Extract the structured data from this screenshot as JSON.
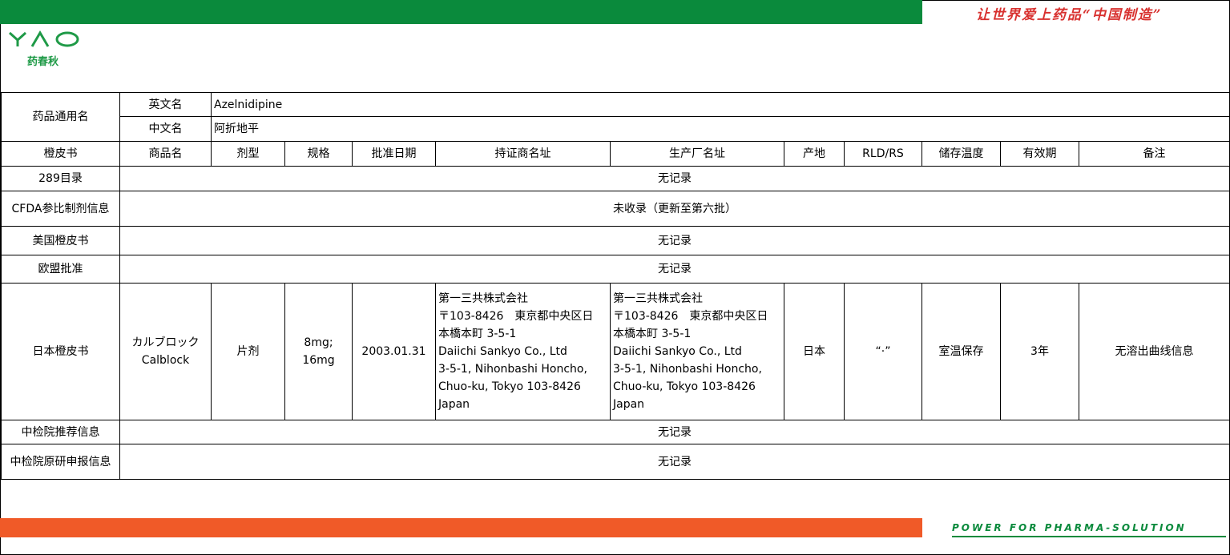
{
  "header": {
    "slogan": "让世界爱上药品“中国制造”",
    "logo_text": "YAO",
    "logo_cn": "药春秋",
    "footer_slogan": "POWER FOR PHARMA-SOLUTION"
  },
  "drug": {
    "generic_label": "药品通用名",
    "en_label": "英文名",
    "en_value": "Azelnidipine",
    "cn_label": "中文名",
    "cn_value": "阿折地平"
  },
  "columns": [
    "橙皮书",
    "商品名",
    "剂型",
    "规格",
    "批准日期",
    "持证商名址",
    "生产厂名址",
    "产地",
    "RLD/RS",
    "储存温度",
    "有效期",
    "备注"
  ],
  "rows": {
    "r289": {
      "label": "289目录",
      "value": "无记录"
    },
    "cfda": {
      "label": "CFDA参比制剂信息",
      "value": "未收录（更新至第六批）"
    },
    "us": {
      "label": "美国橙皮书",
      "value": "无记录"
    },
    "eu": {
      "label": "欧盟批准",
      "value": "无记录"
    },
    "jp": {
      "label": "日本橙皮书",
      "trade_name": [
        "カルブロック",
        "Calblock"
      ],
      "dosage_form": "片剂",
      "strength": [
        "8mg;",
        "16mg"
      ],
      "approval_date": "2003.01.31",
      "holder": [
        "第一三共株式会社",
        "〒103-8426　東京都中央区日",
        "本橋本町 3-5-1",
        "Daiichi Sankyo Co., Ltd",
        "3-5-1, Nihonbashi Honcho,",
        "Chuo-ku, Tokyo 103-8426",
        "Japan"
      ],
      "manufacturer": [
        "第一三共株式会社",
        "〒103-8426　東京都中央区日",
        "本橋本町 3-5-1",
        "Daiichi Sankyo Co., Ltd",
        "3-5-1, Nihonbashi Honcho,",
        "Chuo-ku, Tokyo 103-8426",
        "Japan"
      ],
      "origin": "日本",
      "rld": "“·”",
      "storage": "室温保存",
      "shelf_life": "3年",
      "remark": "无溶出曲线信息"
    },
    "nifdc_rec": {
      "label": "中检院推荐信息",
      "value": "无记录"
    },
    "nifdc_orig": {
      "label": "中检院原研申报信息",
      "value": "无记录"
    }
  },
  "colors": {
    "green": "#0a8a3c",
    "orange": "#f05a28",
    "red": "#d8312f"
  }
}
